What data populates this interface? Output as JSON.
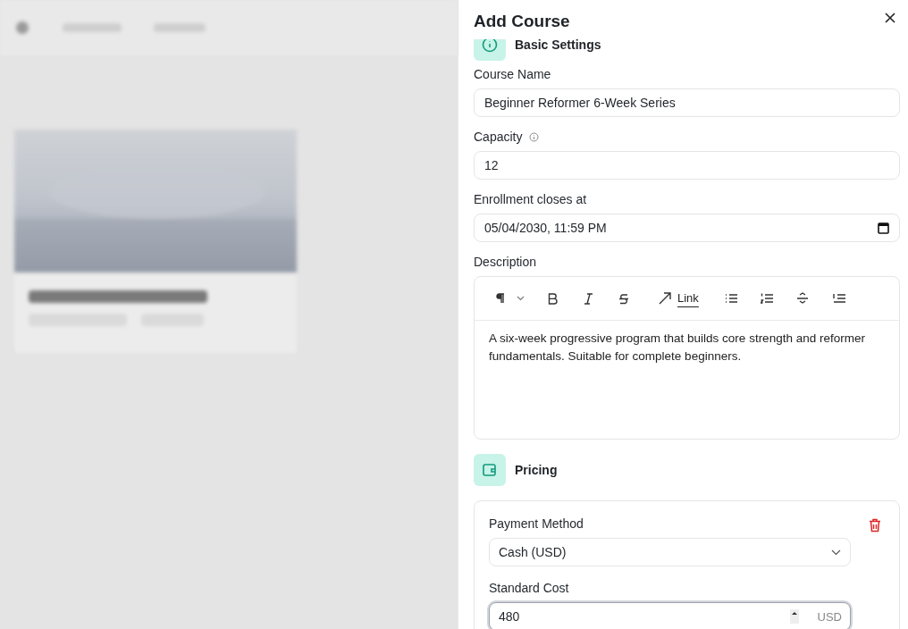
{
  "drawer": {
    "title": "Add Course",
    "basic_settings": {
      "title": "Basic Settings",
      "fields": [
        {
          "kind": "text",
          "label": "Course Name",
          "value": "Beginner Reformer 6-Week Series",
          "info": false
        },
        {
          "kind": "number",
          "label": "Capacity",
          "value": "12",
          "info": true
        },
        {
          "kind": "datetime",
          "label": "Enrollment closes at",
          "value": "05/04/2030, 11:59 PM",
          "info": false
        }
      ]
    },
    "description": {
      "label": "Description",
      "link_label": "Link",
      "text": "A six-week progressive program that builds core strength and reformer fundamentals. Suitable for complete beginners."
    },
    "pricing": {
      "title": "Pricing",
      "payment_method": {
        "label": "Payment Method",
        "value": "Cash (USD)"
      },
      "standard_cost": {
        "label": "Standard Cost",
        "value": "480",
        "currency": "USD",
        "focused": true
      }
    }
  }
}
